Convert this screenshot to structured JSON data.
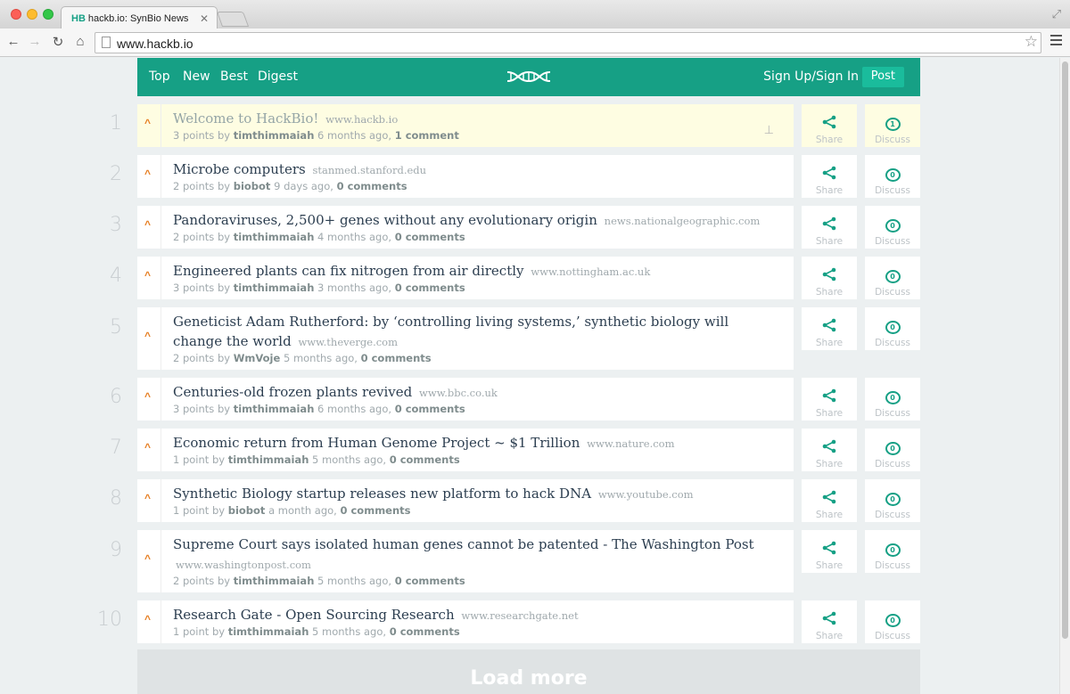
{
  "browser": {
    "tab_title": "hackb.io: SynBio News",
    "tab_favicon": "HB",
    "url": "www.hackb.io"
  },
  "nav": {
    "top": "Top",
    "new": "New",
    "best": "Best",
    "digest": "Digest",
    "sign_in": "Sign Up/Sign In",
    "post": "Post"
  },
  "brand_color": "#16a085",
  "accent_color": "#e67e22",
  "labels": {
    "share": "Share",
    "discuss": "Discuss"
  },
  "stories": [
    {
      "rank": "1",
      "title": "Welcome to HackBio!",
      "domain": "www.hackb.io",
      "points": "3 points by",
      "user": "timthimmaiah",
      "age": "6 months ago,",
      "comments": "1 comment",
      "comment_count": "1",
      "pinned": true
    },
    {
      "rank": "2",
      "title": "Microbe computers",
      "domain": "stanmed.stanford.edu",
      "points": "2 points by",
      "user": "biobot",
      "age": "9 days ago,",
      "comments": "0 comments",
      "comment_count": "0"
    },
    {
      "rank": "3",
      "title": "Pandoraviruses, 2,500+ genes without any evolutionary origin",
      "domain": "news.nationalgeographic.com",
      "points": "2 points by",
      "user": "timthimmaiah",
      "age": "4 months ago,",
      "comments": "0 comments",
      "comment_count": "0"
    },
    {
      "rank": "4",
      "title": "Engineered plants can fix nitrogen from air directly",
      "domain": "www.nottingham.ac.uk",
      "points": "3 points by",
      "user": "timthimmaiah",
      "age": "3 months ago,",
      "comments": "0 comments",
      "comment_count": "0"
    },
    {
      "rank": "5",
      "title": "Geneticist Adam Rutherford: by ‘controlling living systems,’ synthetic biology will change the world",
      "domain": "www.theverge.com",
      "points": "2 points by",
      "user": "WmVoje",
      "age": "5 months ago,",
      "comments": "0 comments",
      "comment_count": "0"
    },
    {
      "rank": "6",
      "title": "Centuries-old frozen plants revived",
      "domain": "www.bbc.co.uk",
      "points": "3 points by",
      "user": "timthimmaiah",
      "age": "6 months ago,",
      "comments": "0 comments",
      "comment_count": "0"
    },
    {
      "rank": "7",
      "title": "Economic return from Human Genome Project ~ $1 Trillion",
      "domain": "www.nature.com",
      "points": "1 point by",
      "user": "timthimmaiah",
      "age": "5 months ago,",
      "comments": "0 comments",
      "comment_count": "0"
    },
    {
      "rank": "8",
      "title": "Synthetic Biology startup releases new platform to hack DNA",
      "domain": "www.youtube.com",
      "points": "1 point by",
      "user": "biobot",
      "age": "a month ago,",
      "comments": "0 comments",
      "comment_count": "0"
    },
    {
      "rank": "9",
      "title": "Supreme Court says isolated human genes cannot be patented - The Washington Post",
      "domain": "www.washingtonpost.com",
      "points": "2 points by",
      "user": "timthimmaiah",
      "age": "5 months ago,",
      "comments": "0 comments",
      "comment_count": "0"
    },
    {
      "rank": "10",
      "title": "Research Gate - Open Sourcing Research",
      "domain": "www.researchgate.net",
      "points": "1 point by",
      "user": "timthimmaiah",
      "age": "5 months ago,",
      "comments": "0 comments",
      "comment_count": "0"
    }
  ],
  "load_more": "Load more"
}
